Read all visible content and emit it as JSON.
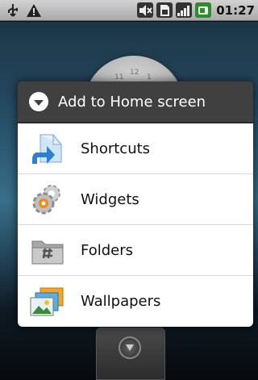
{
  "status_bar": {
    "icons_left": [
      "usb-icon",
      "warning-icon"
    ],
    "icons_right": [
      "mute-icon",
      "sim-icon",
      "signal-icon",
      "battery-icon"
    ],
    "time": "01:27"
  },
  "home": {
    "clock_numbers": [
      "11",
      "12",
      "1"
    ]
  },
  "dialog": {
    "title": "Add to Home screen",
    "items": [
      {
        "label": "Shortcuts",
        "icon": "shortcut-icon"
      },
      {
        "label": "Widgets",
        "icon": "widgets-gear-icon"
      },
      {
        "label": "Folders",
        "icon": "folder-icon"
      },
      {
        "label": "Wallpapers",
        "icon": "wallpapers-icon"
      }
    ]
  },
  "colors": {
    "title_bar": "#404040",
    "list_background": "#ffffff",
    "status_bar": "#bdbdbd"
  }
}
